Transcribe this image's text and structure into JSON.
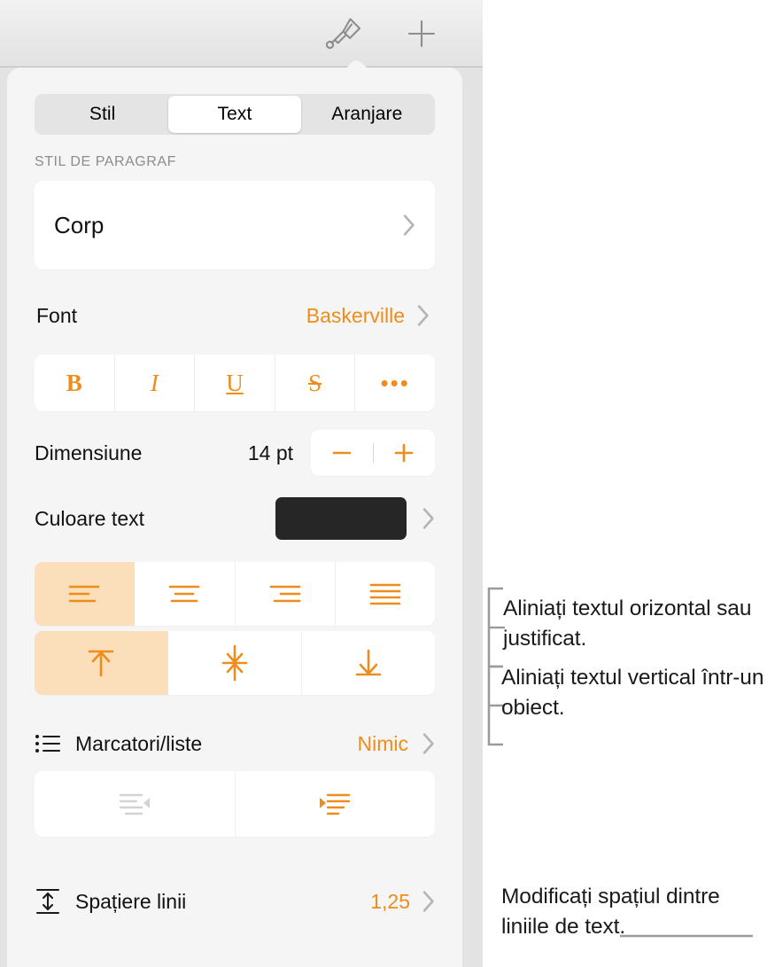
{
  "app": {
    "language": "ro",
    "accent_color": "#ee8c1c",
    "selected_fill": "#fbdfba",
    "panel_background": "#f5f5f5",
    "card_background": "#ffffff"
  },
  "toolbar": {
    "format_brush_icon": "paintbrush-icon",
    "add_icon": "plus-icon"
  },
  "segmented_control": {
    "tabs": [
      {
        "label": "Stil",
        "selected": false
      },
      {
        "label": "Text",
        "selected": true
      },
      {
        "label": "Aranjare",
        "selected": false
      }
    ]
  },
  "paragraph_style": {
    "section_label": "STIL DE PARAGRAF",
    "value": "Corp"
  },
  "font": {
    "label": "Font",
    "value": "Baskerville"
  },
  "style_buttons": [
    {
      "name": "bold",
      "glyph": "B",
      "active": true
    },
    {
      "name": "italic",
      "glyph": "I",
      "active": false
    },
    {
      "name": "underline",
      "glyph": "U",
      "active": false
    },
    {
      "name": "strikethrough",
      "glyph": "S",
      "active": false
    },
    {
      "name": "more-options",
      "glyph": "•••",
      "active": false
    }
  ],
  "size": {
    "label": "Dimensiune",
    "value": "14 pt",
    "decrease_icon": "minus-icon",
    "increase_icon": "plus-icon"
  },
  "text_color": {
    "label": "Culoare text",
    "swatch_color": "#262626"
  },
  "horizontal_alignment": {
    "options": [
      {
        "name": "align-left",
        "selected": true
      },
      {
        "name": "align-center",
        "selected": false
      },
      {
        "name": "align-right",
        "selected": false
      },
      {
        "name": "align-justify",
        "selected": false
      }
    ]
  },
  "vertical_alignment": {
    "options": [
      {
        "name": "align-top",
        "selected": true
      },
      {
        "name": "align-middle",
        "selected": false
      },
      {
        "name": "align-bottom",
        "selected": false
      }
    ]
  },
  "bullets": {
    "icon": "bullet-list-icon",
    "label": "Marcatori/liste",
    "value": "Nimic"
  },
  "indent": {
    "decrease": {
      "name": "decrease-indent",
      "enabled": false
    },
    "increase": {
      "name": "increase-indent",
      "enabled": true
    }
  },
  "line_spacing": {
    "icon": "line-spacing-icon",
    "label": "Spațiere linii",
    "value": "1,25"
  },
  "callouts": [
    {
      "id": "horizontal-alignment",
      "text": "Aliniați textul orizontal sau justificat."
    },
    {
      "id": "vertical-alignment",
      "text": "Aliniați textul vertical într-un obiect."
    },
    {
      "id": "line-spacing",
      "text": "Modificați spațiul dintre liniile de text."
    }
  ]
}
